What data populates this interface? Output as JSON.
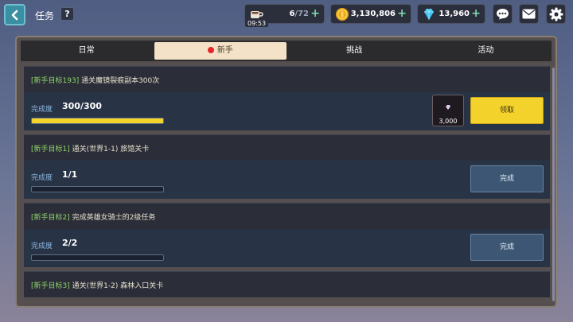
{
  "header": {
    "title": "任务",
    "help_label": "?"
  },
  "resources": {
    "stamina_current": "6",
    "stamina_max": "/72",
    "stamina_timer": "09:53",
    "gold": "3,130,806",
    "gems": "13,960"
  },
  "tabs": [
    {
      "label": "日常",
      "active": false
    },
    {
      "label": "新手",
      "active": true,
      "has_alert": true
    },
    {
      "label": "挑战",
      "active": false
    },
    {
      "label": "活动",
      "active": false
    }
  ],
  "quests": [
    {
      "tag": "[新手目标193]",
      "title": "通关魔镜裂痕副本300次",
      "progress_label": "完成度",
      "progress": "300/300",
      "progress_fraction": 1.0,
      "reward_amount": "3,000",
      "action_label": "领取",
      "state": "claimable"
    },
    {
      "tag": "[新手目标1]",
      "title": "通关(世界1-1) 旅馆关卡",
      "progress_label": "完成度",
      "progress": "1/1",
      "progress_fraction": 0,
      "action_label": "完成",
      "state": "done"
    },
    {
      "tag": "[新手目标2]",
      "title": "完成英雄女骑士的2级任务",
      "progress_label": "完成度",
      "progress": "2/2",
      "progress_fraction": 0,
      "action_label": "完成",
      "state": "done"
    },
    {
      "tag": "[新手目标3]",
      "title": "通关(世界1-2) 森林入口关卡"
    }
  ]
}
